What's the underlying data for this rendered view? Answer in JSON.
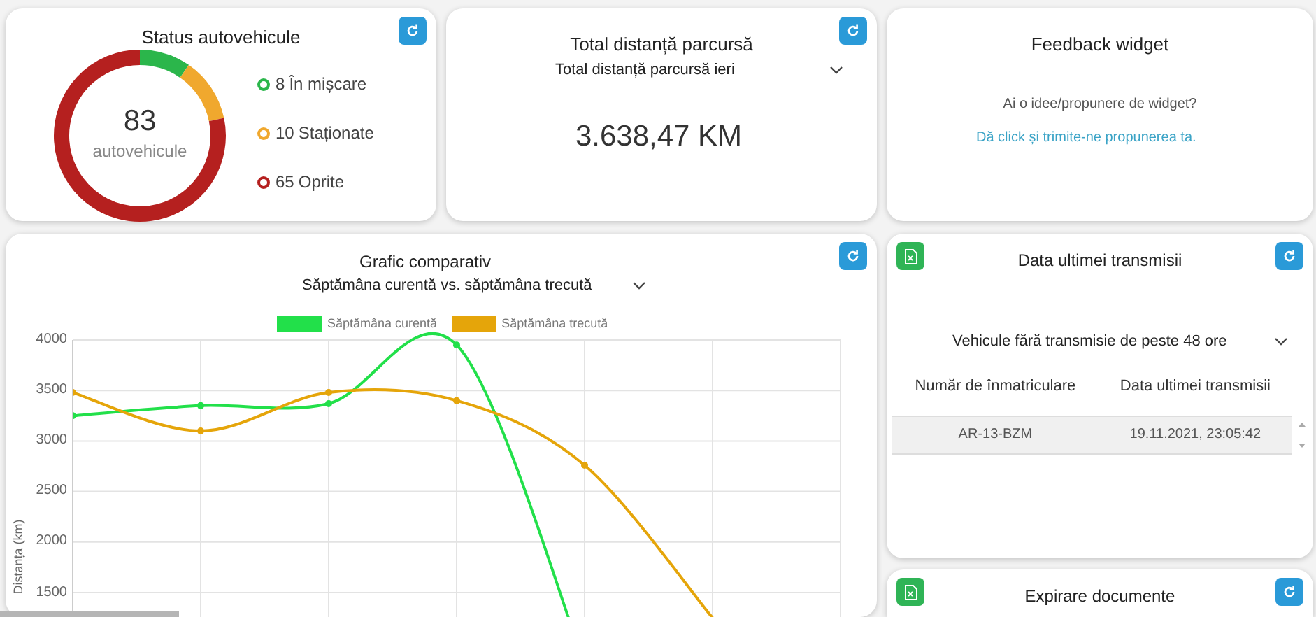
{
  "vehicle_status": {
    "title": "Status autovehicule",
    "total": "83",
    "total_label": "autovehicule",
    "statuses": [
      {
        "count": "8",
        "label": "În mișcare",
        "color": "#2bb64b"
      },
      {
        "count": "10",
        "label": "Staționate",
        "color": "#f0a82e"
      },
      {
        "count": "65",
        "label": "Oprite",
        "color": "#b5201f"
      }
    ]
  },
  "total_distance": {
    "title": "Total distanță parcursă",
    "period": "Total distanță parcursă ieri",
    "value": "3.638,47 KM"
  },
  "feedback": {
    "title": "Feedback widget",
    "question": "Ai o idee/propunere de widget?",
    "link": "Dă click și trimite-ne propunerea ta."
  },
  "comparison": {
    "title": "Grafic comparativ",
    "period": "Săptămâna curentă vs. săptămâna trecută",
    "chart_data": {
      "type": "line",
      "ylabel": "Distanța (km)",
      "categories": [
        null,
        null,
        null,
        null,
        null,
        null,
        null
      ],
      "ylim": [
        500,
        4000
      ],
      "grid": true,
      "yticks": [
        1500,
        2000,
        2500,
        3000,
        3500,
        4000
      ],
      "series": [
        {
          "name": "Săptămâna curentă",
          "color": "#22e04a",
          "marker": "circle",
          "values": [
            3250,
            3350,
            3370,
            3950,
            800,
            null,
            null
          ]
        },
        {
          "name": "Săptămâna trecută",
          "color": "#e5a50a",
          "marker": "circle",
          "values": [
            3480,
            3100,
            3480,
            3400,
            2760,
            1250,
            null
          ]
        }
      ]
    }
  },
  "last_transmission": {
    "title": "Data ultimei transmisii",
    "filter": "Vehicule fără transmisie de peste 48 ore",
    "columns": [
      "Număr de înmatriculare",
      "Data ultimei transmisii"
    ],
    "rows": [
      [
        "AR-13-BZM",
        "19.11.2021, 23:05:42"
      ]
    ]
  },
  "documents": {
    "title": "Expirare documente"
  }
}
